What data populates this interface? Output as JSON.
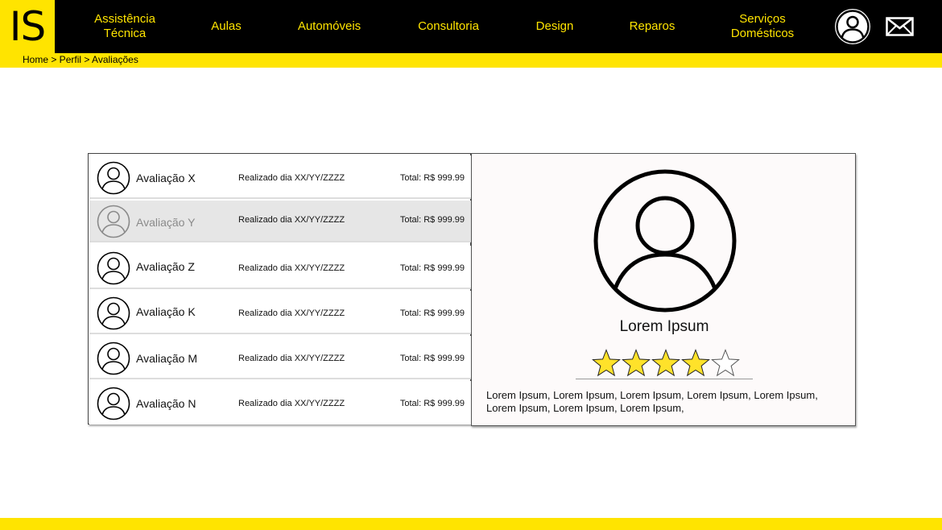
{
  "header": {
    "logo": "IS",
    "nav": [
      {
        "label": "Assistência\nTécnica"
      },
      {
        "label": "Aulas"
      },
      {
        "label": "Automóveis"
      },
      {
        "label": "Consultoria"
      },
      {
        "label": "Design"
      },
      {
        "label": "Reparos"
      },
      {
        "label": "Serviços\nDomésticos"
      }
    ],
    "icons": {
      "avatar": "user-avatar-icon",
      "mail": "mail-icon"
    }
  },
  "breadcrumb": "Home > Perfil > Avaliações",
  "reviews": [
    {
      "name": "Avaliação X",
      "date": "Realizado dia XX/YY/ZZZZ",
      "total": "Total: R$ 999.99",
      "selected": false
    },
    {
      "name": "Avaliação Y",
      "date": "Realizado dia XX/YY/ZZZZ",
      "total": "Total: R$ 999.99",
      "selected": true
    },
    {
      "name": "Avaliação Z",
      "date": "Realizado dia XX/YY/ZZZZ",
      "total": "Total: R$ 999.99",
      "selected": false
    },
    {
      "name": "Avaliação K",
      "date": "Realizado dia XX/YY/ZZZZ",
      "total": "Total: R$ 999.99",
      "selected": false
    },
    {
      "name": "Avaliação M",
      "date": "Realizado dia XX/YY/ZZZZ",
      "total": "Total: R$ 999.99",
      "selected": false
    },
    {
      "name": "Avaliação N",
      "date": "Realizado dia XX/YY/ZZZZ",
      "total": "Total: R$ 999.99",
      "selected": false
    }
  ],
  "detail": {
    "name": "Lorem Ipsum",
    "rating": 4,
    "rating_max": 5,
    "description": "Lorem Ipsum, Lorem Ipsum, Lorem Ipsum, Lorem Ipsum, Lorem Ipsum, Lorem Ipsum, Lorem Ipsum, Lorem Ipsum,"
  },
  "colors": {
    "accent": "#ffe400",
    "header_bg": "#000000",
    "selected_row": "#e6e6e6",
    "star_fill": "#ffe22a"
  }
}
